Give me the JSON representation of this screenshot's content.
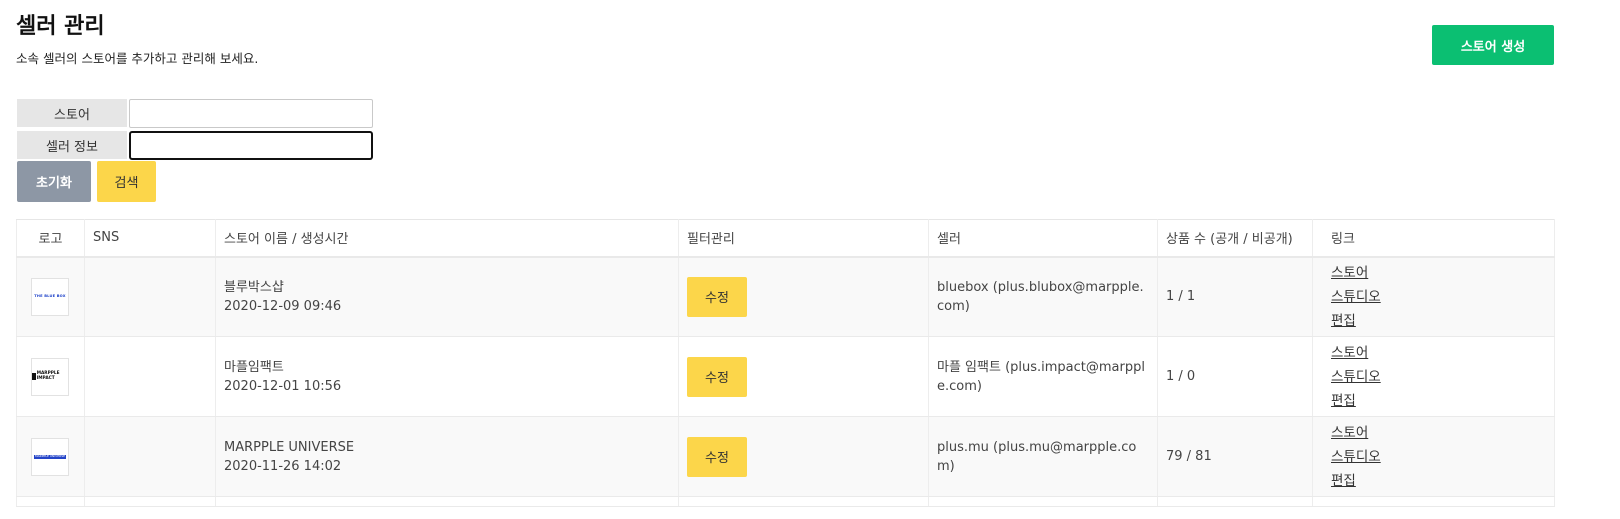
{
  "header": {
    "title": "셀러 관리",
    "subtitle": "소속 셀러의 스토어를 추가하고 관리해 보세요.",
    "create_button": "스토어 생성"
  },
  "filter": {
    "store_label": "스토어",
    "store_value": "",
    "seller_label": "셀러 정보",
    "seller_value": "",
    "reset_button": "초기화",
    "search_button": "검색"
  },
  "table": {
    "columns": [
      "로고",
      "SNS",
      "스토어 이름 / 생성시간",
      "필터관리",
      "셀러",
      "상품 수 (공개 / 비공개)",
      "링크"
    ],
    "edit_label": "수정",
    "links": [
      "스토어",
      "스튜디오",
      "편집"
    ],
    "rows": [
      {
        "logo": "THE BLUE BOX",
        "sns": "",
        "name": "블루박스샵",
        "created": "2020-12-09 09:46",
        "seller": "bluebox  (plus.blubox@marpple.com)",
        "products": "1 / 1"
      },
      {
        "logo": "MARPPLE IMPACT",
        "sns": "",
        "name": "마플임팩트",
        "created": "2020-12-01 10:56",
        "seller": "마플 임팩트  (plus.impact@marpple.com)",
        "products": "1 / 0"
      },
      {
        "logo": "MARPPLE UNIVERSE",
        "sns": "",
        "name": "MARPPLE UNIVERSE",
        "created": "2020-11-26 14:02",
        "seller": "plus.mu  (plus.mu@marpple.com)",
        "products": "79 / 81"
      }
    ]
  },
  "colors": {
    "create_button": "#0bbf72",
    "search_button": "#fcd64a",
    "reset_button": "#8d97a5",
    "edit_button": "#fcd64a"
  }
}
